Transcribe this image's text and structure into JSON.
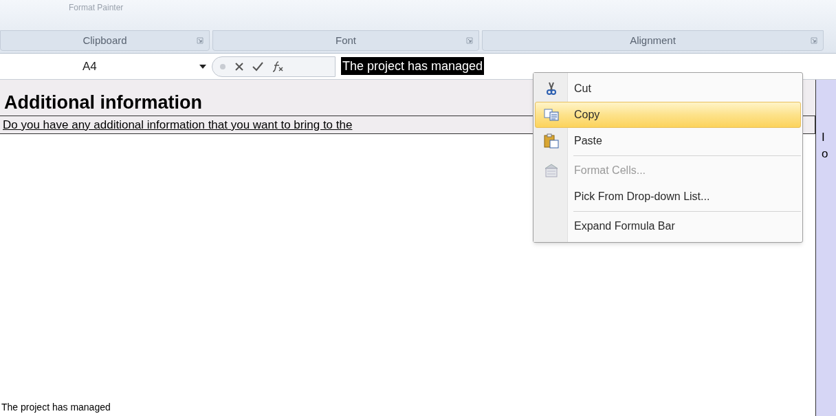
{
  "ribbon": {
    "top_button": "Format Painter",
    "groups": [
      {
        "label": "Clipboard"
      },
      {
        "label": "Font"
      },
      {
        "label": "Alignment"
      }
    ]
  },
  "formula_bar": {
    "name_box": "A4",
    "value": "The project has managed"
  },
  "sheet": {
    "heading": "Additional information",
    "question": "Do you have any additional information that you want to bring to the",
    "side_lines": [
      "I",
      "o"
    ],
    "cell_text": "The project has managed"
  },
  "context_menu": [
    {
      "kind": "item",
      "label": "Cut",
      "selected": false,
      "disabled": false
    },
    {
      "kind": "item",
      "label": "Copy",
      "selected": true,
      "disabled": false
    },
    {
      "kind": "item",
      "label": "Paste",
      "selected": false,
      "disabled": false
    },
    {
      "kind": "separator"
    },
    {
      "kind": "item",
      "label": "Format Cells...",
      "selected": false,
      "disabled": true
    },
    {
      "kind": "item",
      "label": "Pick From Drop-down List...",
      "selected": false,
      "disabled": false
    },
    {
      "kind": "separator"
    },
    {
      "kind": "item",
      "label": "Expand Formula Bar",
      "selected": false,
      "disabled": false
    }
  ]
}
